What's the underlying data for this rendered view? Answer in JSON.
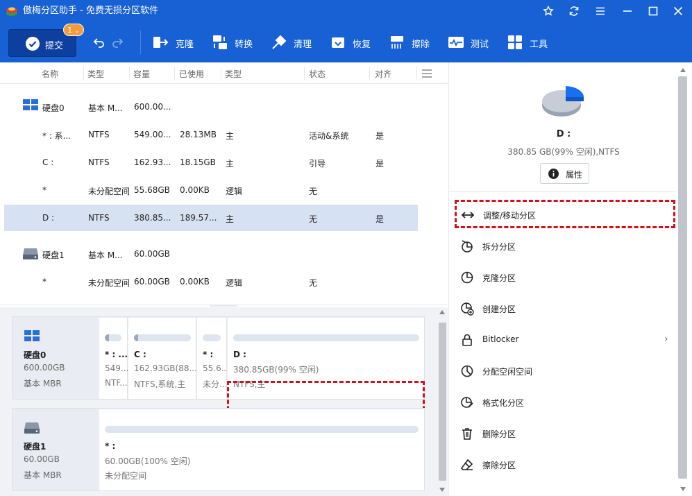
{
  "app": {
    "title": "傲梅分区助手 - 免费无损分区软件"
  },
  "toolbar": {
    "commit_label": "提交",
    "commit_badge": "1",
    "tools": [
      {
        "label": "克隆",
        "icon": "clone-icon"
      },
      {
        "label": "转换",
        "icon": "convert-icon"
      },
      {
        "label": "清理",
        "icon": "cleanup-icon"
      },
      {
        "label": "恢复",
        "icon": "recover-icon"
      },
      {
        "label": "擦除",
        "icon": "wipe-icon"
      },
      {
        "label": "测试",
        "icon": "test-icon"
      },
      {
        "label": "工具",
        "icon": "tools-icon"
      }
    ]
  },
  "columns": [
    "名称",
    "类型",
    "容量",
    "已使用",
    "类型",
    "状态",
    "对齐"
  ],
  "rows": [
    {
      "name": "硬盘0",
      "type": "基本 M...",
      "capacity": "600.00...",
      "used": "",
      "ptype": "",
      "status": "",
      "align": ""
    },
    {
      "name": "* : 系...",
      "type": "NTFS",
      "capacity": "549.00...",
      "used": "28.13MB",
      "ptype": "主",
      "status": "活动&系统",
      "align": "是"
    },
    {
      "name": "C :",
      "type": "NTFS",
      "capacity": "162.93...",
      "used": "18.15GB",
      "ptype": "主",
      "status": "引导",
      "align": "是"
    },
    {
      "name": "*",
      "type": "未分配空间",
      "capacity": "55.68GB",
      "used": "0.00KB",
      "ptype": "逻辑",
      "status": "无",
      "align": ""
    },
    {
      "name": "D :",
      "type": "NTFS",
      "capacity": "380.85...",
      "used": "189.57...",
      "ptype": "主",
      "status": "无",
      "align": "是"
    },
    {
      "name": "硬盘1",
      "type": "基本 M...",
      "capacity": "60.00GB",
      "used": "",
      "ptype": "",
      "status": "",
      "align": ""
    },
    {
      "name": "*",
      "type": "未分配空间",
      "capacity": "60.00GB",
      "used": "0.00KB",
      "ptype": "逻辑",
      "status": "无",
      "align": ""
    }
  ],
  "diskmap": {
    "disk0": {
      "name": "硬盘0",
      "size": "600.00GB",
      "style": "基本 MBR",
      "parts": [
        {
          "name": "* : ...",
          "size": "549...",
          "type": "NTF..."
        },
        {
          "name": "C :",
          "size": "162.93GB(88...",
          "type": "NTFS,系统,主"
        },
        {
          "name": "* :",
          "size": "55.6...",
          "type": "未分..."
        },
        {
          "name": "D :",
          "size": "380.85GB(99% 空闲)",
          "type": "NTFS,主"
        }
      ]
    },
    "disk1": {
      "name": "硬盘1",
      "size": "60.00GB",
      "style": "基本 MBR",
      "parts": [
        {
          "name": "* :",
          "size": "60.00GB(100% 空闲)",
          "type": "未分配空间"
        }
      ]
    }
  },
  "details": {
    "name": "D :",
    "info": "380.85 GB(99% 空闲),NTFS",
    "props_label": "属性"
  },
  "operations": [
    {
      "label": "调整/移动分区",
      "icon": "resize-icon"
    },
    {
      "label": "拆分分区",
      "icon": "split-icon"
    },
    {
      "label": "克隆分区",
      "icon": "clone-partition-icon"
    },
    {
      "label": "创建分区",
      "icon": "create-icon"
    },
    {
      "label": "Bitlocker",
      "icon": "lock-icon"
    },
    {
      "label": "分配空闲空间",
      "icon": "allocate-icon"
    },
    {
      "label": "格式化分区",
      "icon": "format-icon"
    },
    {
      "label": "删除分区",
      "icon": "trash-icon"
    },
    {
      "label": "擦除分区",
      "icon": "eraser-icon"
    }
  ],
  "colors": {
    "accent": "#1861d4",
    "selection": "#d6e2f2",
    "highlight": "#d0121b"
  }
}
